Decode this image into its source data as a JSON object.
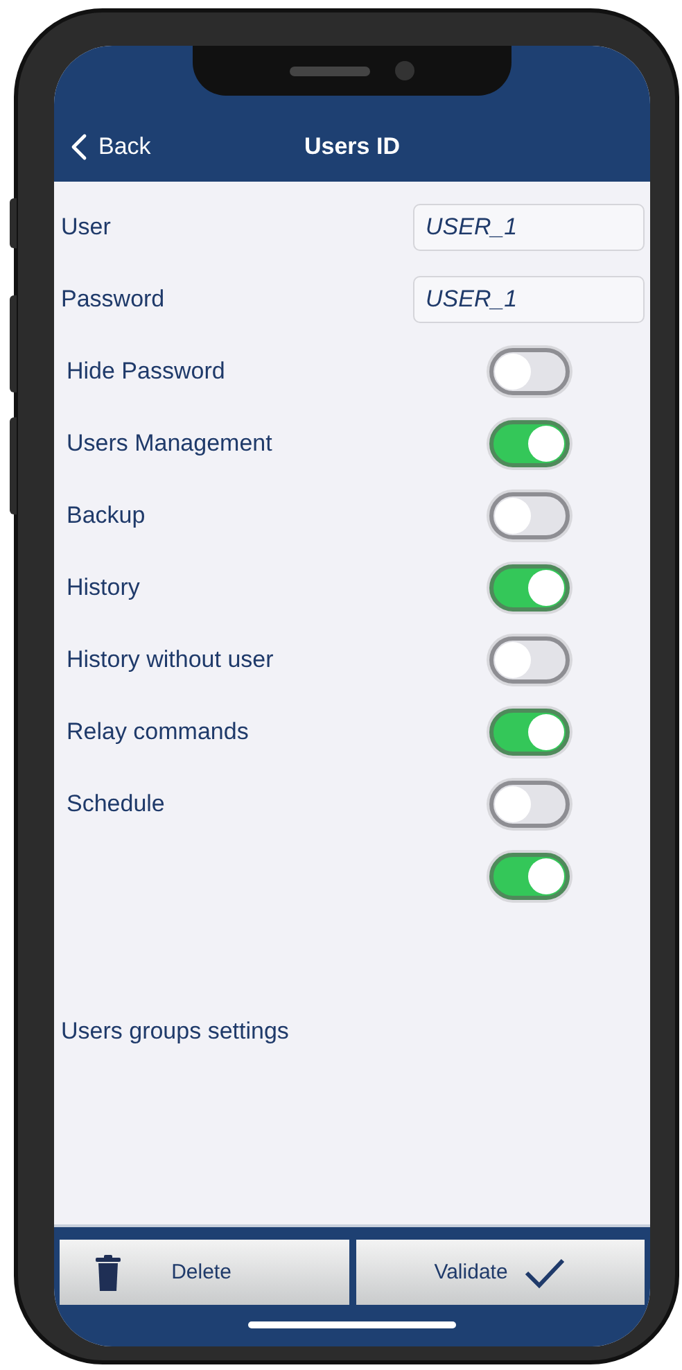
{
  "nav": {
    "back": "Back",
    "title": "Users ID"
  },
  "fields": [
    {
      "label": "User",
      "value": "USER_1"
    },
    {
      "label": "Password",
      "value": "USER_1"
    }
  ],
  "toggles": [
    {
      "label": "Hide Password",
      "on": false
    },
    {
      "label": "Users Management",
      "on": true
    },
    {
      "label": "Backup",
      "on": false
    },
    {
      "label": "History",
      "on": true
    },
    {
      "label": "History without user",
      "on": false
    },
    {
      "label": "Relay commands",
      "on": true
    },
    {
      "label": "Schedule",
      "on": false
    },
    {
      "on": true
    }
  ],
  "section_link": "Users groups settings",
  "buttons": [
    {
      "kind": "delete",
      "label": "Delete"
    },
    {
      "kind": "validate",
      "label": "Validate"
    }
  ]
}
